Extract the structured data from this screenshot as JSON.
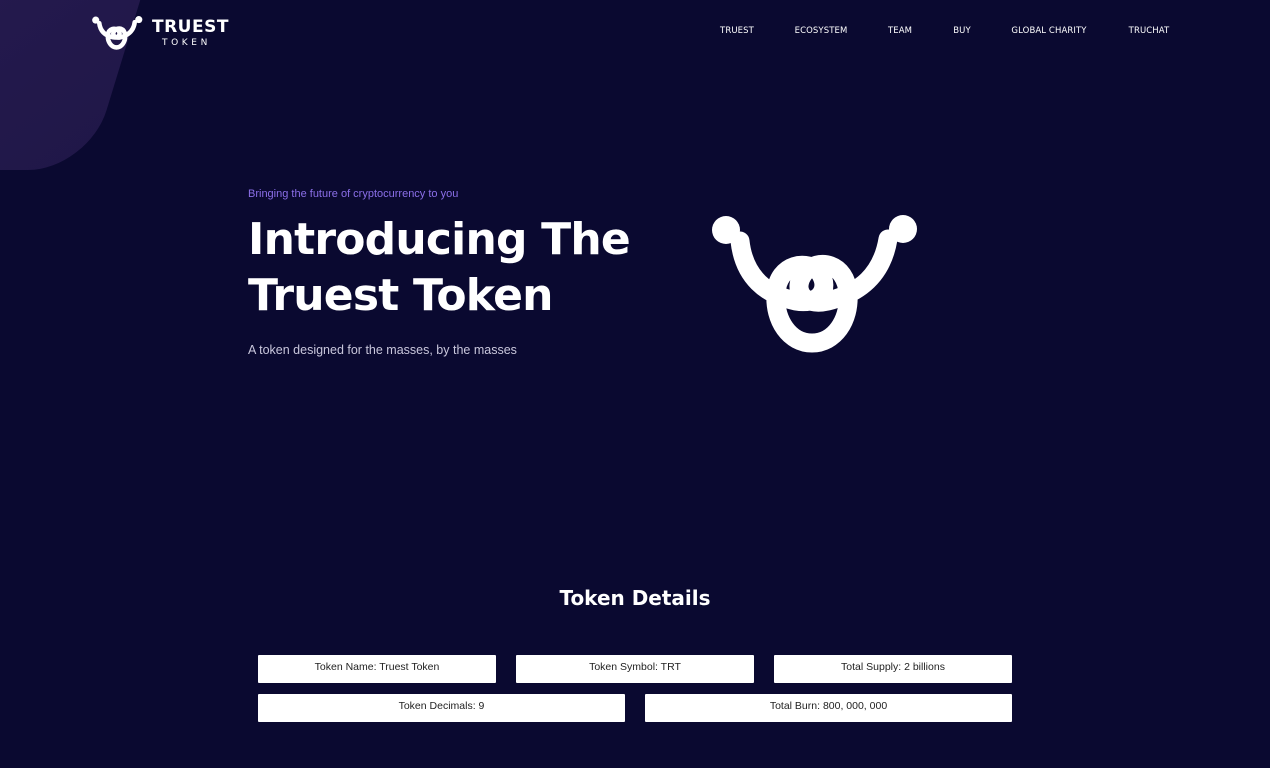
{
  "brand": {
    "name_line1": "TRUEST",
    "name_line2": "TOKEN"
  },
  "nav": {
    "items": [
      "TRUEST",
      "ECOSYSTEM",
      "TEAM",
      "BUY",
      "GLOBAL CHARITY",
      "TRUCHAT"
    ]
  },
  "hero": {
    "eyebrow": "Bringing the future of cryptocurrency to you",
    "title_line1": "Introducing The",
    "title_line2": "Truest Token",
    "subtitle": "A token designed for the masses, by the masses"
  },
  "token_details": {
    "heading": "Token Details",
    "items": [
      "Token Name: Truest Token",
      "Token Symbol: TRT",
      "Total Supply: 2 billions",
      "Token Decimals: 9",
      "Total Burn: 800, 000, 000"
    ]
  },
  "colors": {
    "background": "#0a0930",
    "accent": "#8b6fe8",
    "corner": "#201748"
  },
  "icons": {
    "logo": "truest-knot-logo-icon"
  }
}
